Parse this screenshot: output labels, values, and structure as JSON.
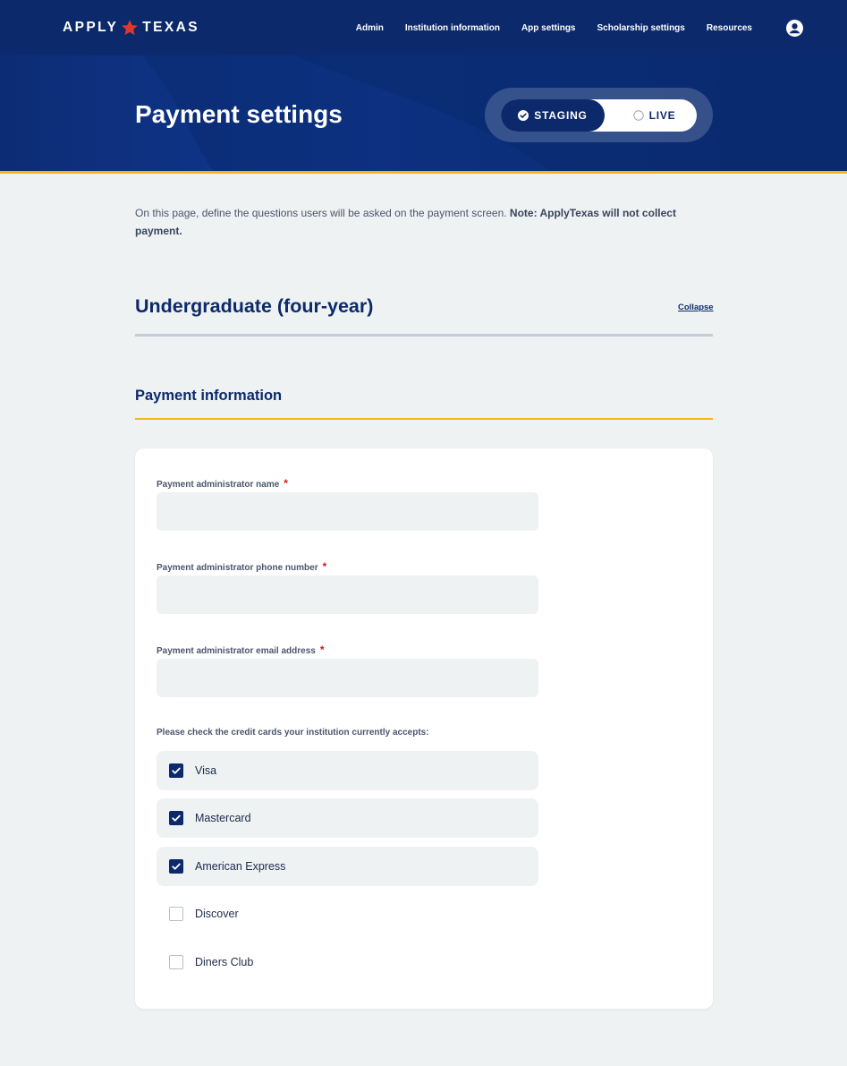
{
  "nav": {
    "logo_left": "APPLY",
    "logo_right": "TEXAS",
    "links": [
      "Admin",
      "Institution information",
      "App settings",
      "Scholarship settings",
      "Resources"
    ],
    "user_icon": "user-circle-icon"
  },
  "hero": {
    "title": "Payment settings",
    "toggle": {
      "staging_label": "STAGING",
      "live_label": "LIVE",
      "selected": "STAGING"
    }
  },
  "intro": {
    "text": "On this page, define the questions users will be asked on the payment screen. ",
    "bold_text": "Note: ApplyTexas will not collect payment."
  },
  "section": {
    "title": "Undergraduate (four-year)",
    "collapse_label": "Collapse"
  },
  "payment": {
    "subtitle": "Payment information",
    "fields": [
      {
        "label": "Payment administrator name",
        "required_mark": "*",
        "value": ""
      },
      {
        "label": "Payment administrator phone number",
        "required_mark": "*",
        "value": ""
      },
      {
        "label": "Payment administrator email address",
        "required_mark": "*",
        "value": ""
      }
    ],
    "cards_label": "Please check the credit cards your institution currently accepts:",
    "cards": [
      {
        "label": "Visa",
        "checked": true
      },
      {
        "label": "Mastercard",
        "checked": true
      },
      {
        "label": "American Express",
        "checked": true
      },
      {
        "label": "Discover",
        "checked": false
      },
      {
        "label": "Diners Club",
        "checked": false
      }
    ]
  },
  "colors": {
    "navy": "#0c2a6b",
    "gold": "#f2b51b",
    "required": "#d3141f",
    "background": "#eef2f3"
  }
}
